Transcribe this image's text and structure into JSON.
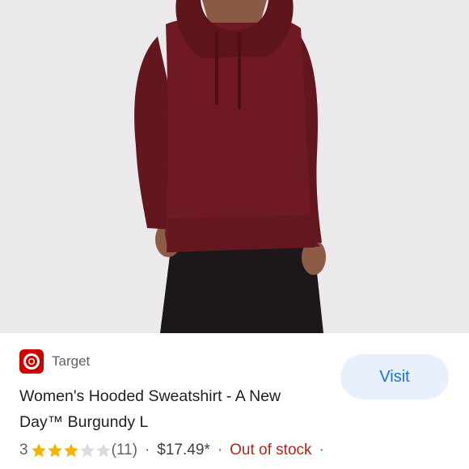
{
  "product_image": {
    "alt": ""
  },
  "store": {
    "name": "Target",
    "logo_icon": "target-logo-icon",
    "brand_color": "#cc0000"
  },
  "visit_button": {
    "label": "Visit"
  },
  "product": {
    "title": "Women's Hooded Sweatshirt - A New Day™ Burgundy L"
  },
  "rating": {
    "value": "3",
    "stars_filled": 3,
    "stars_total": 5,
    "count": "(11)"
  },
  "price": {
    "text": "$17.49*"
  },
  "availability": {
    "text": "Out of stock"
  },
  "separators": {
    "dot": "·"
  },
  "colors": {
    "sweatshirt": "#6f1a22",
    "pants": "#1b1819",
    "visit_bg": "#e8f0fe",
    "visit_text": "#1a73e8",
    "stock_red": "#b3261e",
    "star_gold": "#f4b400"
  }
}
